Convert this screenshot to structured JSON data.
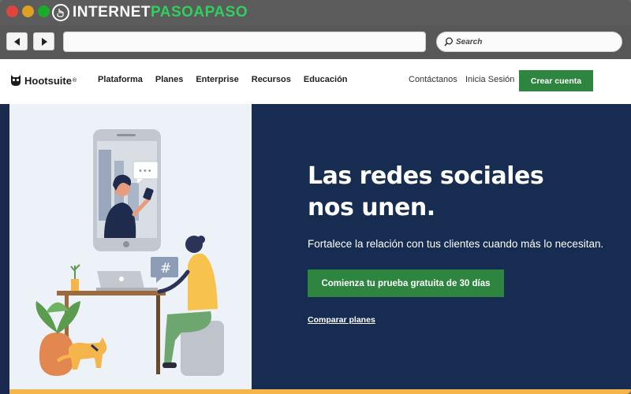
{
  "browser": {
    "brand_part1": "INTERNET",
    "brand_part2": "PASOAPASO",
    "search_placeholder": "Search",
    "colors": {
      "red": "#e0443e",
      "yellow": "#dea123",
      "green": "#1aab29",
      "brand_green": "#2fd05c"
    }
  },
  "header": {
    "logo_text": "Hootsuite",
    "logo_mark": "®",
    "nav": [
      "Plataforma",
      "Planes",
      "Enterprise",
      "Recursos",
      "Educación"
    ],
    "contact": "Contáctanos",
    "login": "Inicia Sesión",
    "signup": "Crear cuenta"
  },
  "hero": {
    "title_line1": "Las redes sociales",
    "title_line2": "nos unen.",
    "subtitle": "Fortalece la relación con tus clientes cuando más lo necesitan.",
    "cta": "Comienza tu prueba gratuita de 30 días",
    "link": "Comparar planes",
    "chat_bubble_text": "•••",
    "hashtag": "#"
  },
  "colors": {
    "cta_green": "#2e8540",
    "hero_navy": "#162c51",
    "hero_left_bg": "#edf1f8",
    "accent_orange": "#f5b54a"
  }
}
